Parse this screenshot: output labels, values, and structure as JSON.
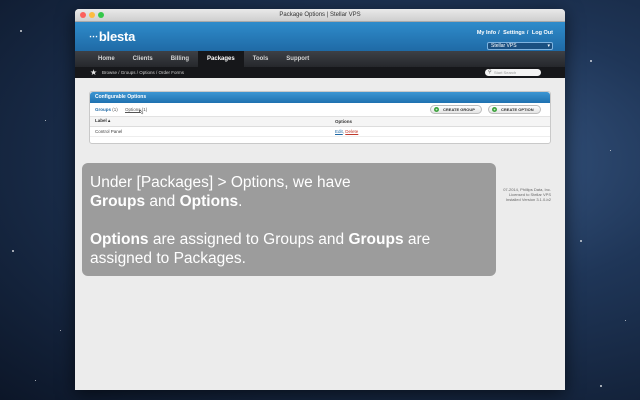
{
  "window": {
    "title": "Package Options | Stellar VPS"
  },
  "header": {
    "logo_text": "blesta",
    "top_links": [
      "My Info",
      "Settings",
      "Log Out"
    ],
    "company": "Stellar VPS"
  },
  "nav": {
    "items": [
      "Home",
      "Clients",
      "Billing",
      "Packages",
      "Tools",
      "Support"
    ],
    "active": "Packages"
  },
  "breadcrumb": "Browse / Groups / Options / Order Forms",
  "search": {
    "placeholder": "Start Search"
  },
  "panel": {
    "title": "Configurable Options",
    "tabs": [
      {
        "label": "Groups",
        "count": "(1)"
      },
      {
        "label": "Options",
        "count": "(1)"
      }
    ],
    "buttons": {
      "create_group": "CREATE GROUP",
      "create_option": "CREATE OPTION"
    },
    "table": {
      "headers": [
        "Label",
        "Options"
      ],
      "rows": [
        {
          "label": "Control Panel",
          "edit": "Edit",
          "delete": "Delete"
        }
      ]
    }
  },
  "footer": {
    "lines": [
      "07-2014, Phillips Data, Inc.",
      "Licensed to Stellar VPS",
      "Installed Version 3.1.0-b2"
    ]
  },
  "overlay": {
    "line1": "Under [Packages] > Options, we have",
    "groups": "Groups",
    "and": " and ",
    "options": "Options",
    "period": ".",
    "options2": "Options",
    "mid": " are assigned to Groups and ",
    "groups2": "Groups",
    "end": " are assigned to Packages."
  }
}
